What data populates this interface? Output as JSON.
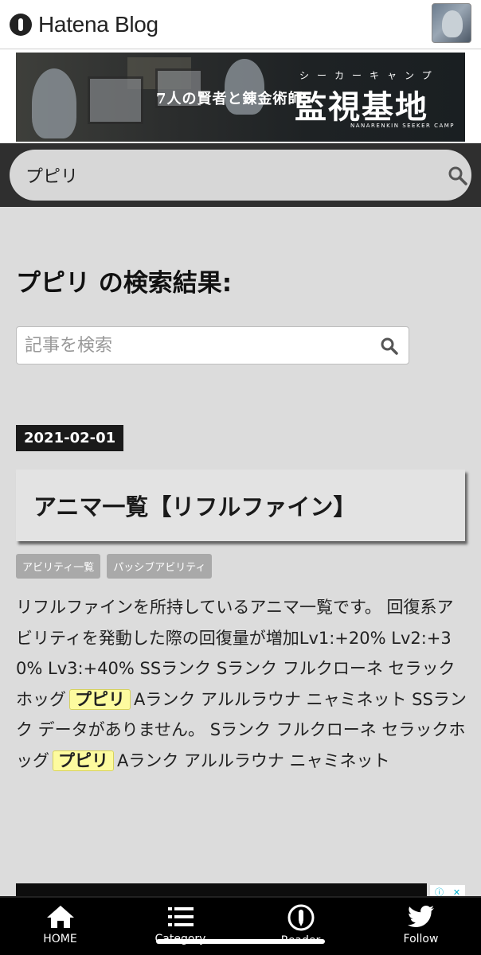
{
  "app": {
    "brand": "Hatena Blog"
  },
  "banner": {
    "subtitle": "7人の賢者と錬金術師",
    "title": "監視基地",
    "kana": "シーカーキャンプ",
    "english": "NANARENKIN SEEKER CAMP"
  },
  "header_search": {
    "value": "プピリ"
  },
  "page": {
    "heading": "プピリ の検索結果:",
    "search_placeholder": "記事を検索"
  },
  "article": {
    "date": "2021-02-01",
    "title": "アニマ一覧【リフルファイン】",
    "tags": [
      "アビリティ一覧",
      "パッシブアビリティ"
    ],
    "excerpt_segments": [
      "リフルファインを所持しているアニマ一覧です。 回復系アビリティを発動した際の回復量が増加Lv1:+20% Lv2:+30% Lv3:+40% SSランク Sランク フルクローネ セラックホッグ",
      "プピリ",
      "Aランク アルルラウナ ニャミネット SSランク データがありません。 Sランク フルクローネ セラックホッグ",
      "プピリ",
      "Aランク アルルラウナ ニャミネット"
    ]
  },
  "bottom_nav": [
    {
      "label": "HOME",
      "icon": "home-icon"
    },
    {
      "label": "Category",
      "icon": "list-icon"
    },
    {
      "label": "Reader",
      "icon": "pen-icon"
    },
    {
      "label": "Follow",
      "icon": "twitter-icon"
    }
  ],
  "colors": {
    "background": "#dcdcdc",
    "highlight": "#fdfb9f",
    "nav": "#000000"
  }
}
